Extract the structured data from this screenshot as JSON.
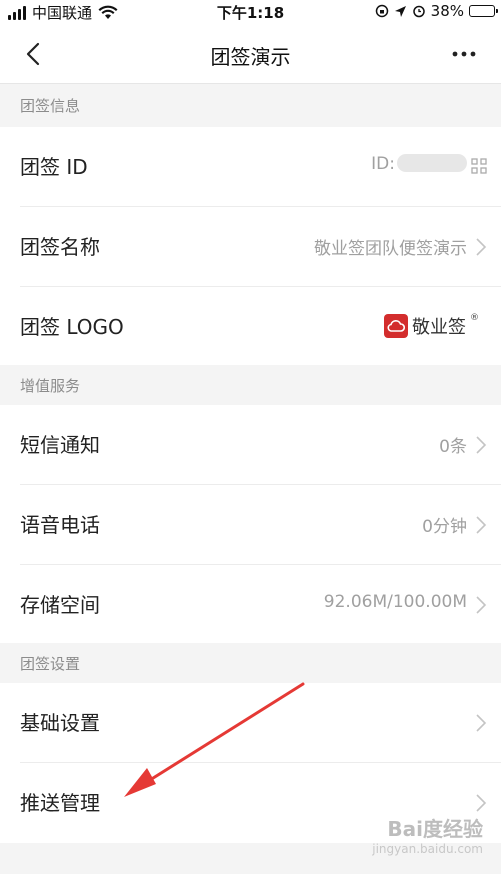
{
  "status_bar": {
    "carrier": "中国联通",
    "time": "下午1:18",
    "battery": "38%",
    "battery_level": 0.38
  },
  "nav": {
    "title": "团签演示",
    "back_icon": "chevron-left-icon",
    "more_icon": "more-dots-icon"
  },
  "sections": {
    "info": "团签信息",
    "value_added": "增值服务",
    "settings": "团签设置"
  },
  "rows": {
    "team_id": {
      "label": "团签 ID",
      "value_prefix": "ID:"
    },
    "team_name": {
      "label": "团签名称",
      "value": "敬业签团队便签演示"
    },
    "team_logo": {
      "label": "团签 LOGO",
      "logo_text": "敬业签",
      "logo_mark": "®"
    },
    "sms": {
      "label": "短信通知",
      "value": "0条"
    },
    "voice": {
      "label": "语音电话",
      "value": "0分钟"
    },
    "storage": {
      "label": "存储空间",
      "value": "92.06M/100.00M"
    },
    "basic_settings": {
      "label": "基础设置"
    },
    "push_management": {
      "label": "推送管理"
    }
  },
  "colors": {
    "accent_red": "#d32d2d",
    "annotation_red": "#e53935",
    "section_bg": "#f4f4f4"
  },
  "watermark": {
    "line1": "Bai度经验",
    "line2": "jingyan.baidu.com"
  }
}
